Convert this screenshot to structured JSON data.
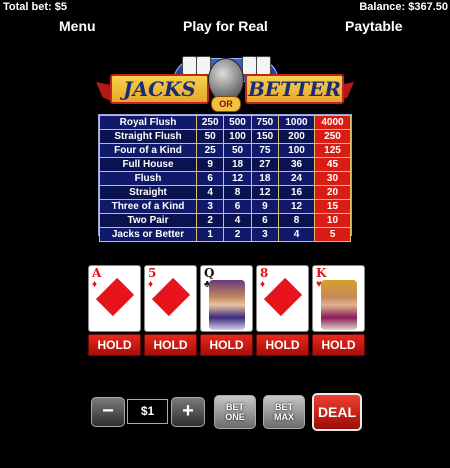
{
  "header": {
    "total_bet": "Total bet: $5",
    "balance": "Balance: $367.50"
  },
  "nav": {
    "menu": "Menu",
    "play": "Play for Real",
    "paytable": "Paytable"
  },
  "logo": {
    "left": "JACKS",
    "or": "OR",
    "right": "BETTER"
  },
  "paytable": {
    "active_column_index": 4,
    "rows": [
      {
        "hand": "Royal Flush",
        "pays": [
          "250",
          "500",
          "750",
          "1000",
          "4000"
        ]
      },
      {
        "hand": "Straight Flush",
        "pays": [
          "50",
          "100",
          "150",
          "200",
          "250"
        ]
      },
      {
        "hand": "Four of a Kind",
        "pays": [
          "25",
          "50",
          "75",
          "100",
          "125"
        ]
      },
      {
        "hand": "Full House",
        "pays": [
          "9",
          "18",
          "27",
          "36",
          "45"
        ]
      },
      {
        "hand": "Flush",
        "pays": [
          "6",
          "12",
          "18",
          "24",
          "30"
        ]
      },
      {
        "hand": "Straight",
        "pays": [
          "4",
          "8",
          "12",
          "16",
          "20"
        ]
      },
      {
        "hand": "Three of a Kind",
        "pays": [
          "3",
          "6",
          "9",
          "12",
          "15"
        ]
      },
      {
        "hand": "Two Pair",
        "pays": [
          "2",
          "4",
          "6",
          "8",
          "10"
        ]
      },
      {
        "hand": "Jacks or Better",
        "pays": [
          "1",
          "2",
          "3",
          "4",
          "5"
        ]
      }
    ]
  },
  "cards": [
    {
      "rank": "A",
      "suit": "♦",
      "color": "red",
      "face": "pip"
    },
    {
      "rank": "5",
      "suit": "♦",
      "color": "red",
      "face": "pip"
    },
    {
      "rank": "Q",
      "suit": "♣",
      "color": "black",
      "face": "queen"
    },
    {
      "rank": "8",
      "suit": "♦",
      "color": "red",
      "face": "pip"
    },
    {
      "rank": "K",
      "suit": "♥",
      "color": "red",
      "face": "king"
    }
  ],
  "hold_label": "HOLD",
  "controls": {
    "minus": "−",
    "plus": "+",
    "bet_value": "$1",
    "bet_one_line1": "BET",
    "bet_one_line2": "ONE",
    "bet_max_line1": "BET",
    "bet_max_line2": "MAX",
    "deal": "DEAL"
  },
  "colors": {
    "accent_red": "#d81e14",
    "table_bg": "#0b0f4a"
  }
}
